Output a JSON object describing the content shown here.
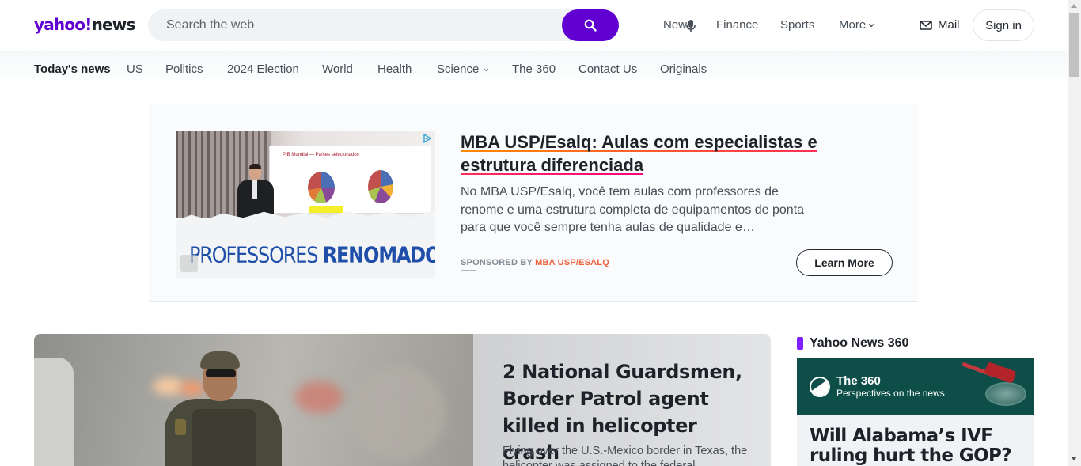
{
  "header": {
    "logo_yahoo": "yahoo!",
    "logo_news": "news",
    "search_placeholder": "Search the web",
    "nav": [
      "News",
      "Finance",
      "Sports",
      "More"
    ],
    "mail_label": "Mail",
    "signin_label": "Sign in",
    "accent_color": "#6001d2"
  },
  "subnav": {
    "items": [
      "Today's news",
      "US",
      "Politics",
      "2024 Election",
      "World",
      "Health",
      "Science",
      "The 360",
      "Contact Us",
      "Originals"
    ],
    "active": "Today's news"
  },
  "ad": {
    "image_board_title": "PIB Mundial — Países selecionados",
    "image_slogan_regular": "PROFESSORES",
    "image_slogan_bold": "RENOMADOS",
    "title": "MBA USP/Esalq: Aulas com especialistas e estrutura diferenciada",
    "description": "No MBA USP/Esalq, você tem aulas com professores de renome e uma estrutura completa de equipamentos de ponta para que você sempre tenha aulas de qualidade e…",
    "sponsored_prefix": "SPONSORED BY",
    "sponsor": "MBA USP/ESALQ",
    "cta": "Learn More"
  },
  "hero": {
    "title": "2 National Guardsmen, Border Patrol agent killed in helicopter crash",
    "description": "Flying over the U.S.-Mexico border in Texas, the helicopter was assigned to the federal"
  },
  "sidebar": {
    "section_label": "Yahoo News 360",
    "banner_title": "The 360",
    "banner_subtitle": "Perspectives on the news",
    "card_title": "Will Alabama’s IVF ruling hurt the GOP?"
  }
}
